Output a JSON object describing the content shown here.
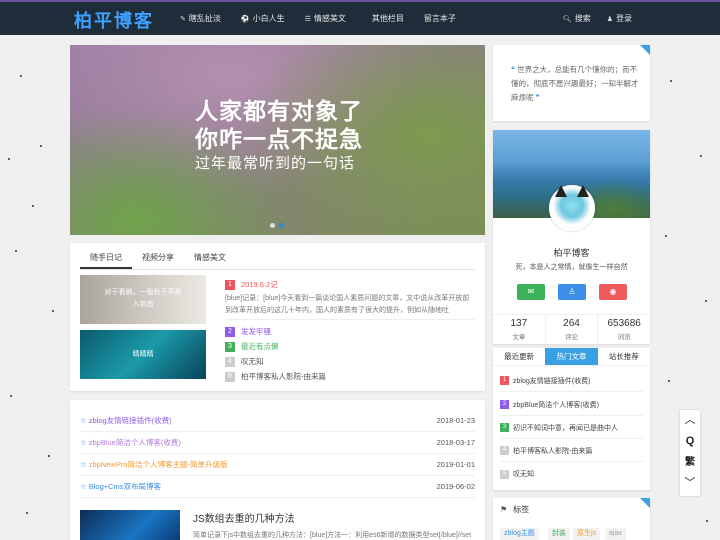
{
  "header": {
    "logo": "柏平博客",
    "nav": [
      {
        "label": "瞎乱扯淡",
        "icon": "edit-icon",
        "glyph": "✎"
      },
      {
        "label": "小白人生",
        "icon": "soccer-icon",
        "glyph": "⚽"
      },
      {
        "label": "情感美文",
        "icon": "list-icon",
        "glyph": "☰"
      },
      {
        "label": "其他栏目",
        "icon": "",
        "glyph": ""
      },
      {
        "label": "留言本子",
        "icon": "",
        "glyph": ""
      }
    ],
    "search_label": "搜索",
    "login_label": "登录"
  },
  "banner": {
    "line1": "人家都有对象了",
    "line2": "你咋一点不捉急",
    "line3": "过年最常听到的一句话"
  },
  "diary": {
    "tabs": [
      "随手日记",
      "视频分享",
      "情感美文"
    ],
    "thumb1_text": "对于看剧，一般处于不投\n入状态",
    "thumb2_text": "晴晴晴",
    "items": [
      {
        "num": "1",
        "title": "2019.6.2记"
      },
      {
        "num": "2",
        "title": "发发牢骚"
      },
      {
        "num": "3",
        "title": "最近有点懒"
      },
      {
        "num": "4",
        "title": "叹无知"
      },
      {
        "num": "5",
        "title": "柏平博客私人影院-由来篇"
      }
    ],
    "excerpt": "[blue]记录：[blue]今天看到一篇谈论国人素质问题的文章，文中说从改革开放前到改革开放后的这几十年内，国人的素质有了很大的提升，例如从随地吐"
  },
  "links": [
    {
      "title": "zblog友情链接插件(收费)",
      "date": "2018-01-23",
      "color": "#8e5ce6"
    },
    {
      "title": "zbpBlue简洁个人博客(收费)",
      "date": "2018-03-17",
      "color": "#b27de0"
    },
    {
      "title": "zbpNewPro简洁个人博客主题-简单升级版",
      "date": "2019-01-01",
      "color": "#f29b30"
    },
    {
      "title": "Blog+Cms双布局博客",
      "date": "2019-06-02",
      "color": "#3a8ee6"
    }
  ],
  "post": {
    "title": "JS数组去重的几种方法",
    "excerpt": "简单记录下js中数组去重的几种方法：[blue]方法一：利用es6新增的数据类型set[/blue]//set"
  },
  "quote": {
    "text": "世界之大，总能有几个懂你的；而不懂的，彻底不愿兴趣最好；一知半解才麻烦呢"
  },
  "profile": {
    "name": "柏平博客",
    "bio": "死，本是人之常情，就像生一样自然",
    "stats": [
      {
        "num": "137",
        "label": "文章"
      },
      {
        "num": "264",
        "label": "评论"
      },
      {
        "num": "653686",
        "label": "浏览"
      }
    ]
  },
  "recent": {
    "tabs": [
      "最近更新",
      "热门文章",
      "站长推荐"
    ],
    "items": [
      {
        "num": "1",
        "title": "zblog友情链接插件(收费)"
      },
      {
        "num": "2",
        "title": "zbpBlue简洁个人博客(收费)"
      },
      {
        "num": "3",
        "title": "初识不知词中意，再闻已是曲中人"
      },
      {
        "num": "4",
        "title": "柏平博客私人影院-由来篇"
      },
      {
        "num": "5",
        "title": "叹无知"
      }
    ]
  },
  "tags": {
    "title": "标签",
    "items": [
      "zblog主题",
      "封装",
      "原生js",
      "ajax"
    ]
  },
  "floatbar": {
    "up": "︿",
    "qq": "Q",
    "trad": "繁",
    "down": "﹀"
  }
}
